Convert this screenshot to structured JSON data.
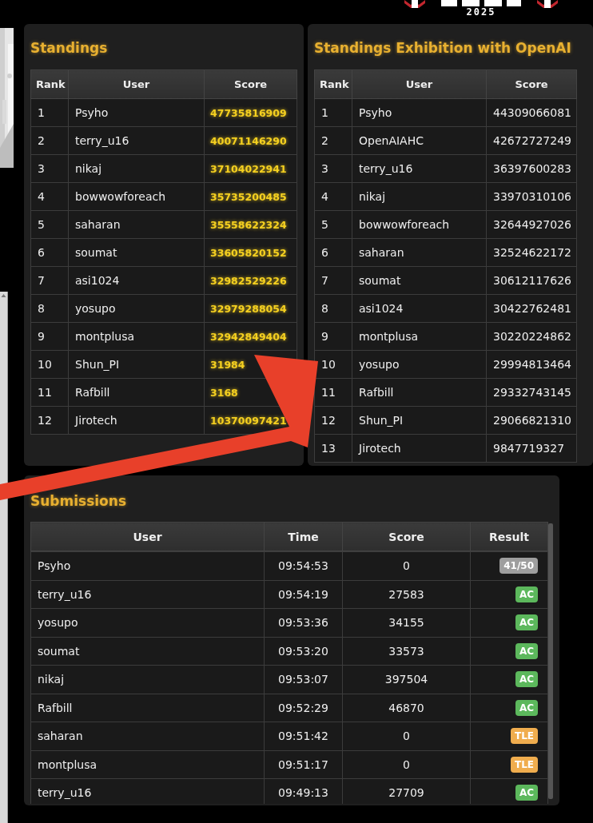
{
  "logo": {
    "year": "2025"
  },
  "standings": {
    "title": "Standings",
    "columns": [
      "Rank",
      "User",
      "Score"
    ],
    "rows": [
      {
        "rank": "1",
        "user": "Psyho",
        "score": "47735816909"
      },
      {
        "rank": "2",
        "user": "terry_u16",
        "score": "40071146290"
      },
      {
        "rank": "3",
        "user": "nikaj",
        "score": "37104022941"
      },
      {
        "rank": "4",
        "user": "bowwowforeach",
        "score": "35735200485"
      },
      {
        "rank": "5",
        "user": "saharan",
        "score": "35558622324"
      },
      {
        "rank": "6",
        "user": "soumat",
        "score": "33605820152"
      },
      {
        "rank": "7",
        "user": "asi1024",
        "score": "32982529226"
      },
      {
        "rank": "8",
        "user": "yosupo",
        "score": "32979288054"
      },
      {
        "rank": "9",
        "user": "montplusa",
        "score": "32942849404"
      },
      {
        "rank": "10",
        "user": "Shun_PI",
        "score": "31984"
      },
      {
        "rank": "11",
        "user": "Rafbill",
        "score": "3168"
      },
      {
        "rank": "12",
        "user": "Jirotech",
        "score": "10370097421"
      }
    ]
  },
  "exhibition": {
    "title": "Standings Exhibition with OpenAI",
    "columns": [
      "Rank",
      "User",
      "Score"
    ],
    "rows": [
      {
        "rank": "1",
        "user": "Psyho",
        "score": "44309066081"
      },
      {
        "rank": "2",
        "user": "OpenAIAHC",
        "score": "42672727249"
      },
      {
        "rank": "3",
        "user": "terry_u16",
        "score": "36397600283"
      },
      {
        "rank": "4",
        "user": "nikaj",
        "score": "33970310106"
      },
      {
        "rank": "5",
        "user": "bowwowforeach",
        "score": "32644927026"
      },
      {
        "rank": "6",
        "user": "saharan",
        "score": "32524622172"
      },
      {
        "rank": "7",
        "user": "soumat",
        "score": "30612117626"
      },
      {
        "rank": "8",
        "user": "asi1024",
        "score": "30422762481"
      },
      {
        "rank": "9",
        "user": "montplusa",
        "score": "30220224862"
      },
      {
        "rank": "10",
        "user": "yosupo",
        "score": "29994813464"
      },
      {
        "rank": "11",
        "user": "Rafbill",
        "score": "29332743145"
      },
      {
        "rank": "12",
        "user": "Shun_PI",
        "score": "29066821310"
      },
      {
        "rank": "13",
        "user": "Jirotech",
        "score": "9847719327"
      }
    ]
  },
  "submissions": {
    "title": "Submissions",
    "columns": [
      "User",
      "Time",
      "Score",
      "Result"
    ],
    "rows": [
      {
        "user": "Psyho",
        "time": "09:54:53",
        "score": "0",
        "result": "41/50",
        "color": "#9e9e9e"
      },
      {
        "user": "terry_u16",
        "time": "09:54:19",
        "score": "27583",
        "result": "AC",
        "color": "#5cb85c"
      },
      {
        "user": "yosupo",
        "time": "09:53:36",
        "score": "34155",
        "result": "AC",
        "color": "#5cb85c"
      },
      {
        "user": "soumat",
        "time": "09:53:20",
        "score": "33573",
        "result": "AC",
        "color": "#5cb85c"
      },
      {
        "user": "nikaj",
        "time": "09:53:07",
        "score": "397504",
        "result": "AC",
        "color": "#5cb85c"
      },
      {
        "user": "Rafbill",
        "time": "09:52:29",
        "score": "46870",
        "result": "AC",
        "color": "#5cb85c"
      },
      {
        "user": "saharan",
        "time": "09:51:42",
        "score": "0",
        "result": "TLE",
        "color": "#f0ad4e"
      },
      {
        "user": "montplusa",
        "time": "09:51:17",
        "score": "0",
        "result": "TLE",
        "color": "#f0ad4e"
      },
      {
        "user": "terry_u16",
        "time": "09:49:13",
        "score": "27709",
        "result": "AC",
        "color": "#5cb85c"
      }
    ]
  }
}
